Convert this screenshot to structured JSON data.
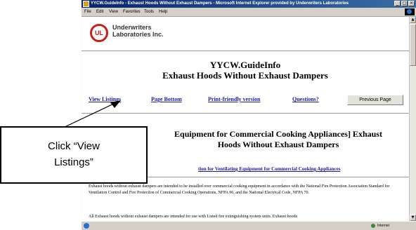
{
  "browser": {
    "title": "YYCW.GuideInfo - Exhaust Hoods Without Exhaust Dampers - Microsoft Internet Explorer provided by Underwriters Laboratories",
    "menu": [
      "File",
      "Edit",
      "View",
      "Favorites",
      "Tools",
      "Help"
    ],
    "status": {
      "zone": "Internet"
    }
  },
  "page": {
    "logo_mark": "UL",
    "org_line1": "Underwriters",
    "org_line2": "Laboratories Inc.",
    "title_line1": "YYCW.GuideInfo",
    "title_line2": "Exhaust Hoods Without Exhaust Dampers",
    "nav": {
      "view_listings": "View Listings",
      "page_bottom": "Page Bottom",
      "print_friendly": "Print-friendly version",
      "questions": "Questions?",
      "previous_page": "Previous Page"
    },
    "section_title_line1": "Equipment for Commercial Cooking Appliances] Exhaust",
    "section_title_line2": "Hoods Without Exhaust Dampers",
    "sub_link": "tion for Ventilating Equipment for Commercial Cooking Appliances",
    "paragraph1": "Exhaust hoods without exhaust dampers are intended to be installed over commercial cooking equipment in accordance with the National Fire Protection Association Standard for Ventilation Control and Fire Protection of Commercial Cooking Operations, NFPA 96, and the National Electrical Code, NFPA 70.",
    "paragraph2": "All Exhaust hoods without exhaust dampers are intended for use with Listed fire extinguishing system units. Exhaust hoods"
  },
  "callout": {
    "line1": "Click “View",
    "line2": "Listings”"
  }
}
